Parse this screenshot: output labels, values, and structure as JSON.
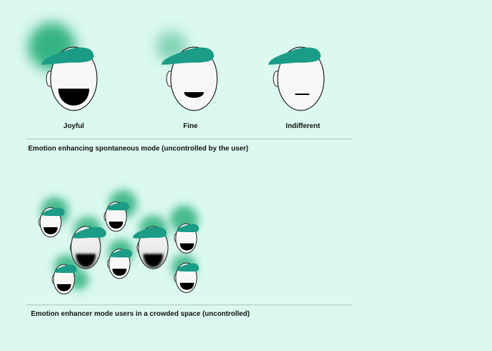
{
  "colors": {
    "background": "#dcf9ef",
    "cap": "#1a9c86",
    "glow": "#2fb07f",
    "face": "#f7f7f7",
    "outline": "#1b1b1b",
    "mouth": "#000000",
    "divider": "#a9c5bd"
  },
  "top_section": {
    "faces": [
      {
        "label": "Joyful",
        "mood": "joyful",
        "glow_level": 1.0
      },
      {
        "label": "Fine",
        "mood": "fine",
        "glow_level": 0.4
      },
      {
        "label": "Indifferent",
        "mood": "indifferent",
        "glow_level": 0.0
      }
    ],
    "caption": "Emotion enhancing spontaneous mode (uncontrolled by the user)"
  },
  "bottom_section": {
    "caption": "Emotion enhancer mode users in a crowded space (uncontrolled)"
  }
}
